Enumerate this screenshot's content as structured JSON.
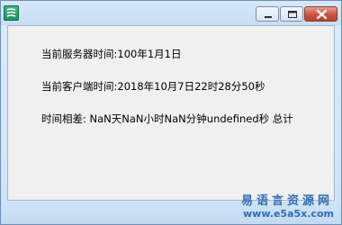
{
  "window": {
    "icon": "app-icon",
    "controls": {
      "minimize_icon": "minimize-icon",
      "maximize_icon": "maximize-icon",
      "close_icon": "close-icon"
    }
  },
  "content": {
    "server_time": "当前服务器时间:100年1月1日",
    "client_time": "当前客户端时间:2018年10月7日22时28分50秒",
    "difference": "时间相差: NaN天NaN小时NaN分钟undefined秒 总计"
  },
  "watermark": {
    "chinese": "易语言资源网",
    "url": "www.e5a5x.com"
  }
}
